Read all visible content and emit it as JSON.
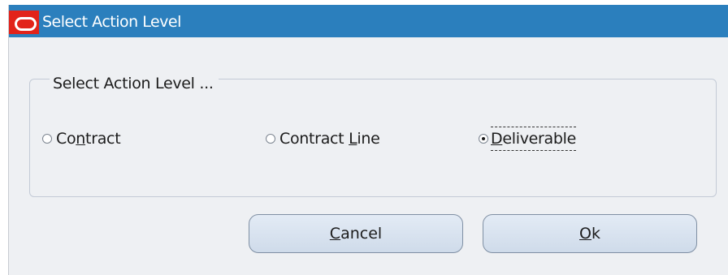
{
  "dialog": {
    "title": "Select Action Level",
    "logo_icon": "oracle-logo-icon"
  },
  "group": {
    "legend": "Select Action Level ..."
  },
  "options": [
    {
      "label_before": "Co",
      "mnemonic": "n",
      "label_after": "tract",
      "checked": false
    },
    {
      "label_before": "Contract ",
      "mnemonic": "L",
      "label_after": "ine",
      "checked": false
    },
    {
      "label_before": "",
      "mnemonic": "D",
      "label_after": "eliverable",
      "checked": true
    }
  ],
  "buttons": {
    "cancel": {
      "mnemonic": "C",
      "rest": "ancel"
    },
    "ok": {
      "mnemonic": "O",
      "rest": "k"
    }
  },
  "colors": {
    "titlebar": "#2b7fbd",
    "logo": "#e2231a",
    "dialog_background": "#eef0f3"
  }
}
